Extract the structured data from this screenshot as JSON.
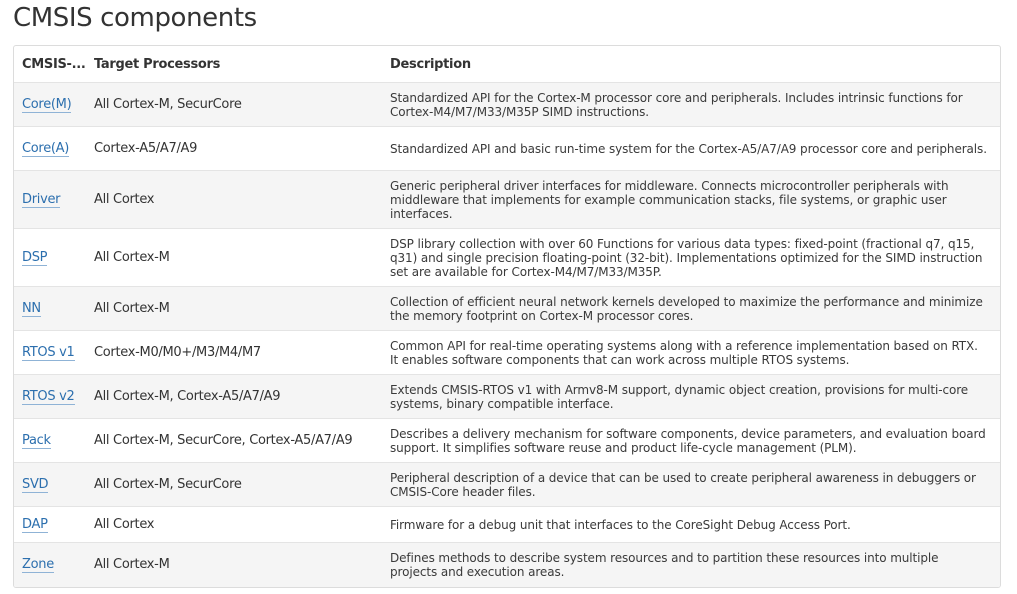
{
  "page": {
    "title": "CMSIS components"
  },
  "table": {
    "headers": [
      "CMSIS-...",
      "Target Processors",
      "Description"
    ],
    "rows": [
      {
        "name": "Core(M)",
        "target": "All Cortex-M, SecurCore",
        "description": "Standardized API for the Cortex-M processor core and peripherals. Includes intrinsic functions for Cortex-M4/M7/M33/M35P SIMD instructions."
      },
      {
        "name": "Core(A)",
        "target": "Cortex-A5/A7/A9",
        "description": "Standardized API and basic run-time system for the Cortex-A5/A7/A9 processor core and peripherals."
      },
      {
        "name": "Driver",
        "target": "All Cortex",
        "description": "Generic peripheral driver interfaces for middleware. Connects microcontroller peripherals with middleware that implements for example communication stacks, file systems, or graphic user interfaces."
      },
      {
        "name": "DSP",
        "target": "All Cortex-M",
        "description": "DSP library collection with over 60 Functions for various data types: fixed-point (fractional q7, q15, q31) and single precision floating-point (32-bit). Implementations optimized for the SIMD instruction set are available for Cortex-M4/M7/M33/M35P."
      },
      {
        "name": "NN",
        "target": "All Cortex-M",
        "description": "Collection of efficient neural network kernels developed to maximize the performance and minimize the memory footprint on Cortex-M processor cores."
      },
      {
        "name": "RTOS v1",
        "target": "Cortex-M0/M0+/M3/M4/M7",
        "description": "Common API for real-time operating systems along with a reference implementation based on RTX. It enables software components that can work across multiple RTOS systems."
      },
      {
        "name": "RTOS v2",
        "target": "All Cortex-M, Cortex-A5/A7/A9",
        "description": "Extends CMSIS-RTOS v1 with Armv8-M support, dynamic object creation, provisions for multi-core systems, binary compatible interface."
      },
      {
        "name": "Pack",
        "target": "All Cortex-M, SecurCore, Cortex-A5/A7/A9",
        "description": "Describes a delivery mechanism for software components, device parameters, and evaluation board support. It simplifies software reuse and product life-cycle management (PLM)."
      },
      {
        "name": "SVD",
        "target": "All Cortex-M, SecurCore",
        "description": "Peripheral description of a device that can be used to create peripheral awareness in debuggers or CMSIS-Core header files."
      },
      {
        "name": "DAP",
        "target": "All Cortex",
        "description": "Firmware for a debug unit that interfaces to the CoreSight Debug Access Port."
      },
      {
        "name": "Zone",
        "target": "All Cortex-M",
        "description": "Defines methods to describe system resources and to partition these resources into multiple projects and execution areas."
      }
    ]
  },
  "colors": {
    "link": "#2c6fae",
    "row_stripe": "#f5f5f5",
    "border": "#dcdcdc"
  }
}
